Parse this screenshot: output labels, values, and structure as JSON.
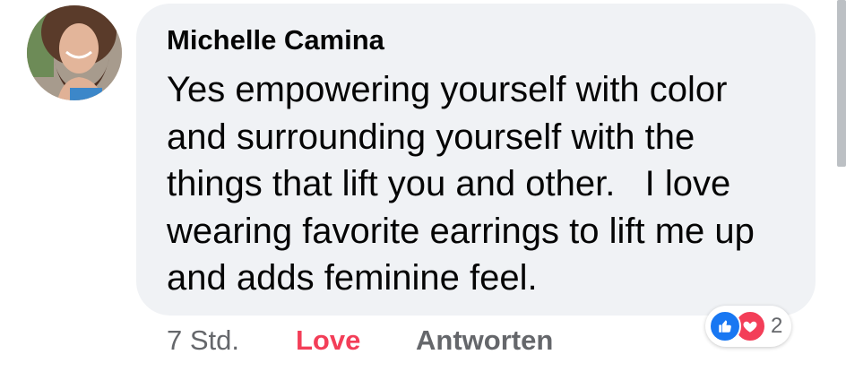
{
  "comment": {
    "author": "Michelle Camina",
    "text_lines": [
      "Yes empowering yourself with color",
      "and surrounding yourself with the",
      "things that lift you and other.   I love",
      "wearing favorite earrings to lift me up",
      "and adds feminine feel."
    ],
    "timestamp": "7 Std.",
    "reaction_action": "Love",
    "reply_action": "Antworten",
    "reaction_count": "2",
    "reaction_types": [
      "like-icon",
      "love-icon"
    ]
  },
  "colors": {
    "bubble": "#f0f2f5",
    "text": "#050505",
    "secondary": "#65676b",
    "love": "#f33e58",
    "like": "#1877f2"
  }
}
